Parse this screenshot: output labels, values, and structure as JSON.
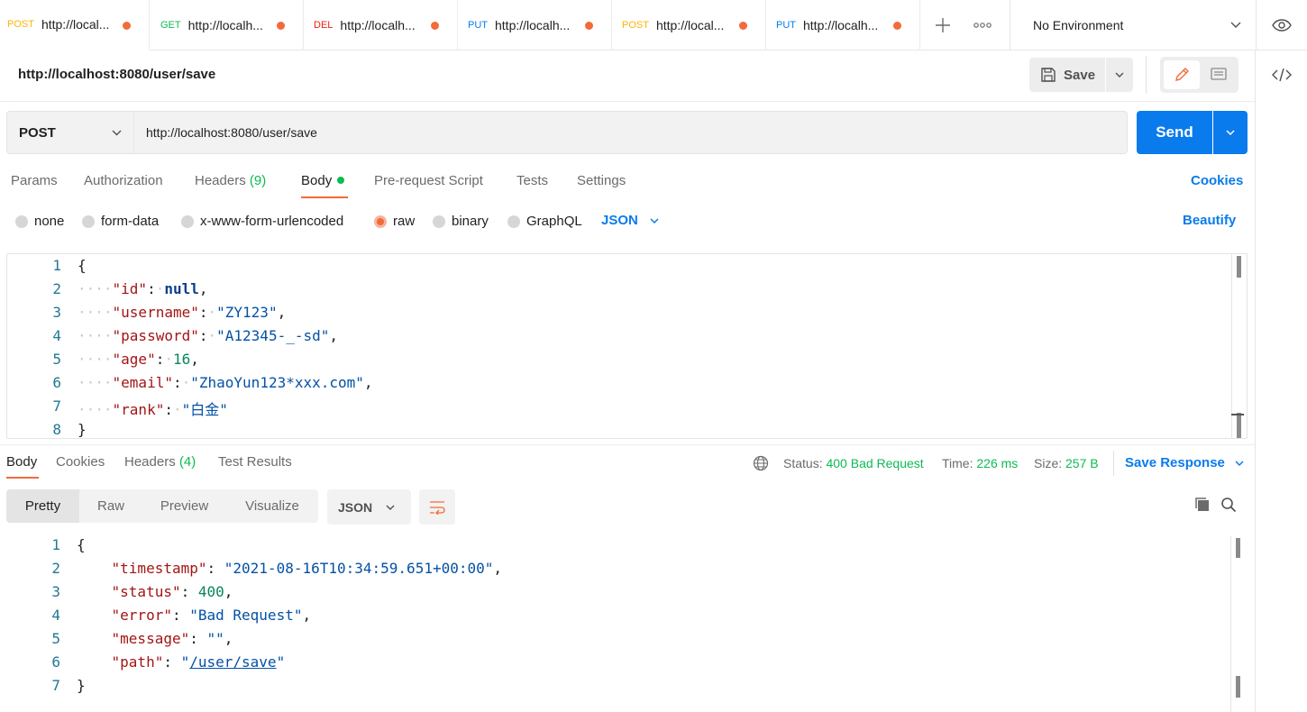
{
  "tabs": [
    {
      "method": "POST",
      "title": "http://local...",
      "method_class": "m-post"
    },
    {
      "method": "GET",
      "title": "http://localh...",
      "method_class": "m-get"
    },
    {
      "method": "DEL",
      "title": "http://localh...",
      "method_class": "m-del"
    },
    {
      "method": "PUT",
      "title": "http://localh...",
      "method_class": "m-put"
    },
    {
      "method": "POST",
      "title": "http://local...",
      "method_class": "m-post"
    },
    {
      "method": "PUT",
      "title": "http://localh...",
      "method_class": "m-put"
    }
  ],
  "environment": {
    "label": "No Environment"
  },
  "request": {
    "title": "http://localhost:8080/user/save",
    "save_label": "Save",
    "method": "POST",
    "url": "http://localhost:8080/user/save",
    "send_label": "Send"
  },
  "request_tabs": {
    "params": "Params",
    "authorization": "Authorization",
    "headers": "Headers",
    "headers_count": "(9)",
    "body": "Body",
    "prerequest": "Pre-request Script",
    "tests": "Tests",
    "settings": "Settings",
    "cookies": "Cookies"
  },
  "body_options": {
    "none": "none",
    "form_data": "form-data",
    "urlencoded": "x-www-form-urlencoded",
    "raw": "raw",
    "binary": "binary",
    "graphql": "GraphQL",
    "format": "JSON",
    "beautify": "Beautify"
  },
  "request_body": {
    "line_numbers": [
      "1",
      "2",
      "3",
      "4",
      "5",
      "6",
      "7",
      "8"
    ],
    "open_brace": "{",
    "close_brace": "}",
    "k_id": "\"id\"",
    "v_id": "null",
    "k_username": "\"username\"",
    "v_username": "\"ZY123\"",
    "k_password": "\"password\"",
    "v_password": "\"A12345-_-sd\"",
    "k_age": "\"age\"",
    "v_age": "16",
    "k_email": "\"email\"",
    "v_email": "\"ZhaoYun123*xxx.com\"",
    "k_rank": "\"rank\"",
    "v_rank": "\"白金\""
  },
  "response_tabs": {
    "body": "Body",
    "cookies": "Cookies",
    "headers": "Headers",
    "headers_count": "(4)",
    "test_results": "Test Results"
  },
  "response_meta": {
    "status_label": "Status:",
    "status_value": "400 Bad Request",
    "time_label": "Time:",
    "time_value": "226 ms",
    "size_label": "Size:",
    "size_value": "257 B",
    "save_response": "Save Response"
  },
  "response_view": {
    "pretty": "Pretty",
    "raw": "Raw",
    "preview": "Preview",
    "visualize": "Visualize",
    "format": "JSON"
  },
  "response_body": {
    "line_numbers": [
      "1",
      "2",
      "3",
      "4",
      "5",
      "6",
      "7"
    ],
    "open_brace": "{",
    "close_brace": "}",
    "k_timestamp": "\"timestamp\"",
    "v_timestamp": "\"2021-08-16T10:34:59.651+00:00\"",
    "k_status": "\"status\"",
    "v_status": "400",
    "k_error": "\"error\"",
    "v_error": "\"Bad Request\"",
    "k_message": "\"message\"",
    "v_message": "\"\"",
    "k_path": "\"path\"",
    "v_path_q1": "\"",
    "v_path": "/user/save",
    "v_path_q2": "\""
  },
  "colors": {
    "accent": "#f26b3a",
    "primary": "#097bed",
    "success": "#0cbb52"
  }
}
